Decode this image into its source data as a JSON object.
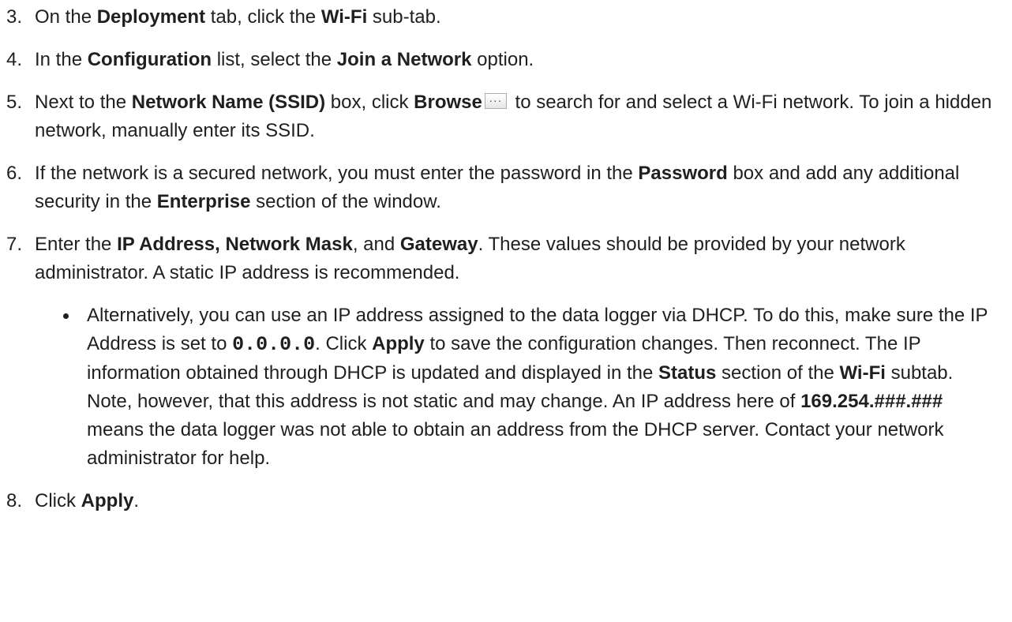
{
  "steps": [
    {
      "num": "3.",
      "t1": "On the ",
      "b1": "Deployment",
      "t2": " tab, click the ",
      "b2": "Wi-Fi",
      "t3": " sub-tab."
    },
    {
      "num": "4.",
      "t1": "In the ",
      "b1": "Configuration",
      "t2": " list, select the ",
      "b2": "Join a Network",
      "t3": " option."
    },
    {
      "num": "5.",
      "t1": "Next to the ",
      "b1": "Network Name (SSID)",
      "t2": " box, click ",
      "b2": "Browse",
      "browse_icon": "ellipsis-button-icon",
      "browse_glyph": "···",
      "t3": " to search for and select a Wi-Fi network. To join a hidden network, manually enter its SSID."
    },
    {
      "num": "6.",
      "t1": "If the network is a secured network, you must enter the password in the ",
      "b1": "Password",
      "t2": " box and add any additional security in the ",
      "b2": "Enterprise",
      "t3": " section of the window."
    },
    {
      "num": "7.",
      "t1": "Enter the ",
      "b1": "IP Address, Network Mask",
      "t2": ", and ",
      "b2": "Gateway",
      "t3": ". These values should be provided by your network administrator. A static IP address is recommended.",
      "bullet": {
        "t1": "Alternatively, you can use an IP address assigned to the data logger via DHCP. To do this, make sure the IP Address is set to ",
        "code": "0.0.0.0",
        "t2": ". Click ",
        "b1": "Apply",
        "t3": " to save the configuration changes. Then reconnect. The IP information obtained through DHCP is updated and displayed in the ",
        "b2": "Status",
        "t4": " section of the ",
        "b3": "Wi-Fi",
        "t5": " subtab. Note, however, that this address is not static and may change. An IP address here of ",
        "b4": "169.254.###.###",
        "t6": " means the data logger was not able to obtain an address from the DHCP server. Contact your network administrator for help."
      }
    },
    {
      "num": "8.",
      "t1": "Click ",
      "b1": "Apply",
      "t2": "."
    }
  ]
}
